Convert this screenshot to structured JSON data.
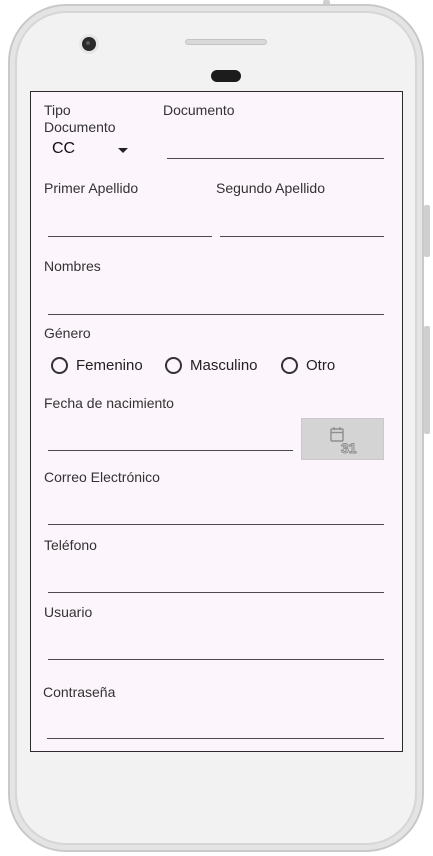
{
  "form": {
    "tipo_documento_label": "Tipo\nDocumento",
    "tipo_documento_value": "CC",
    "documento_label": "Documento",
    "primer_apellido_label": "Primer Apellido",
    "segundo_apellido_label": "Segundo Apellido",
    "nombres_label": "Nombres",
    "genero_label": "Género",
    "genero_options": [
      "Femenino",
      "Masculino",
      "Otro"
    ],
    "fecha_label": "Fecha de nacimiento",
    "calendar_icon_number": "31",
    "correo_label": "Correo Electrónico",
    "telefono_label": "Teléfono",
    "usuario_label": "Usuario",
    "contrasena_label": "Contraseña"
  },
  "icons": {
    "dropdown": "caret-down-icon",
    "date_picker": "calendar-icon"
  },
  "colors": {
    "screen_bg": "#fcf5fc",
    "button_bg": "#d4d4d4",
    "underline": "#4a4a4a"
  }
}
